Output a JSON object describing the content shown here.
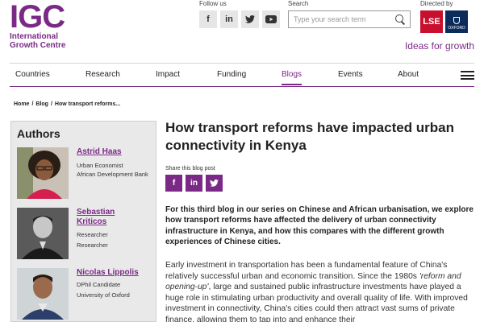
{
  "header": {
    "logo_mark": "IGC",
    "logo_line1": "International",
    "logo_line2": "Growth Centre",
    "follow_label": "Follow us",
    "social": [
      {
        "icon": "facebook-icon",
        "glyph": "f"
      },
      {
        "icon": "linkedin-icon",
        "glyph": "in"
      },
      {
        "icon": "twitter-icon",
        "glyph": "🐦"
      },
      {
        "icon": "youtube-icon",
        "glyph": "▶"
      }
    ],
    "search_label": "Search",
    "search_placeholder": "Type your search term",
    "directed_label": "Directed by",
    "lse_label": "LSE",
    "oxford_label": "OXFORD",
    "tagline": "Ideas for growth"
  },
  "nav": {
    "items": [
      "Countries",
      "Research",
      "Impact",
      "Funding",
      "Blogs",
      "Events",
      "About"
    ],
    "active": "Blogs"
  },
  "breadcrumb": {
    "home": "Home",
    "sep": "/",
    "blog": "Blog",
    "current": "How transport reforms..."
  },
  "sidebar": {
    "title": "Authors",
    "authors": [
      {
        "name": "Astrid Haas",
        "roles": [
          "Urban Economist",
          "African Development Bank"
        ]
      },
      {
        "name_line1": "Sebastian",
        "name_line2": "Kriticos",
        "roles": [
          "Researcher",
          "Researcher"
        ]
      },
      {
        "name": "Nicolas Lippolis",
        "roles": [
          "DPhil Candidate",
          "University of Oxford"
        ]
      }
    ]
  },
  "article": {
    "title": "How transport reforms have impacted urban connectivity in Kenya",
    "share_label": "Share this blog post",
    "intro": "For this third blog in our series on Chinese and African urbanisation, we explore how transport reforms have affected the delivery of urban connectivity infrastructure in Kenya, and how this compares with the different growth experiences of Chinese cities.",
    "body_part1": "Early investment in transportation has been a fundamental feature of China's relatively successful urban and economic transition. Since the 1980s ",
    "body_em": "'reform and opening-up'",
    "body_part2": ", large and sustained public infrastructure investments have played a huge role in stimulating urban productivity and overall quality of life. With improved investment in connectivity, China's cities could then attract vast sums of private finance, allowing them to tap into and enhance their"
  },
  "colors": {
    "brand_purple": "#7a2a86",
    "lse_red": "#c8102e",
    "oxford_blue": "#0b2c5a"
  }
}
